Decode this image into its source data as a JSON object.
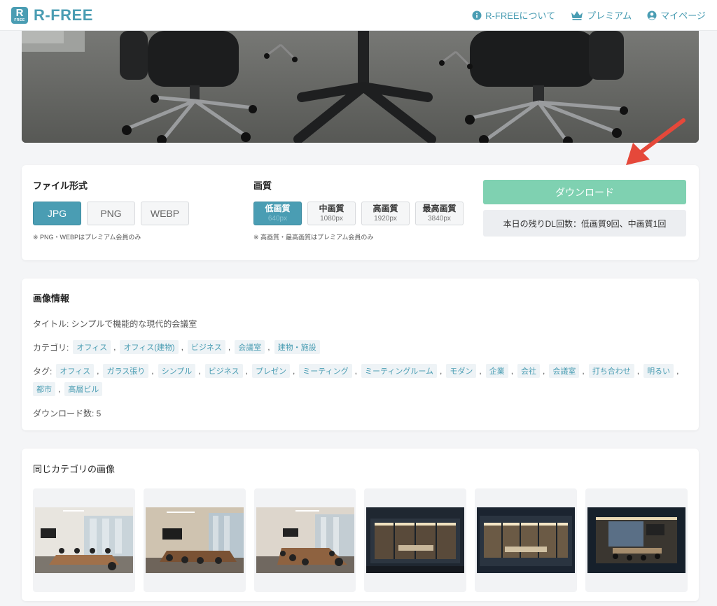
{
  "header": {
    "logo_text": "R-FREE",
    "logo_letter": "R",
    "logo_small": "FREE",
    "nav": [
      {
        "label": "R-FREEについて",
        "icon": "info-icon"
      },
      {
        "label": "プレミアム",
        "icon": "crown-icon"
      },
      {
        "label": "マイページ",
        "icon": "user-icon"
      }
    ]
  },
  "options": {
    "format_title": "ファイル形式",
    "formats": [
      "JPG",
      "PNG",
      "WEBP"
    ],
    "selected_format": "JPG",
    "format_note": "※ PNG・WEBPはプレミアム会員のみ",
    "quality_title": "画質",
    "qualities": [
      {
        "name": "低画質",
        "px": "640px"
      },
      {
        "name": "中画質",
        "px": "1080px"
      },
      {
        "name": "高画質",
        "px": "1920px"
      },
      {
        "name": "最高画質",
        "px": "3840px"
      }
    ],
    "selected_quality": "低画質",
    "quality_note": "※ 高画質・最高画質はプレミアム会員のみ",
    "download_label": "ダウンロード",
    "remaining_label": "本日の残りDL回数：低画質9回、中画質1回"
  },
  "info": {
    "section_title": "画像情報",
    "title_line": "タイトル: シンプルで機能的な現代的会議室",
    "category_label": "カテゴリ:",
    "categories": [
      "オフィス",
      "オフィス(建物)",
      "ビジネス",
      "会議室",
      "建物・施設"
    ],
    "tags_label": "タグ:",
    "tags": [
      "オフィス",
      "ガラス張り",
      "シンプル",
      "ビジネス",
      "プレゼン",
      "ミーティング",
      "ミーティングルーム",
      "モダン",
      "企業",
      "会社",
      "会議室",
      "打ち合わせ",
      "明るい",
      "都市",
      "高層ビル"
    ],
    "downloads_line": "ダウンロード数: 5"
  },
  "related": {
    "section_title": "同じカテゴリの画像",
    "thumbs": [
      {
        "kind": "bright-meeting-room"
      },
      {
        "kind": "warm-meeting-room"
      },
      {
        "kind": "long-table-room"
      },
      {
        "kind": "night-exterior"
      },
      {
        "kind": "night-exterior-wide"
      },
      {
        "kind": "night-interior"
      }
    ]
  },
  "colors": {
    "accent": "#4a9db3",
    "download": "#7fd1b1",
    "annotation_arrow": "#e5483a"
  }
}
